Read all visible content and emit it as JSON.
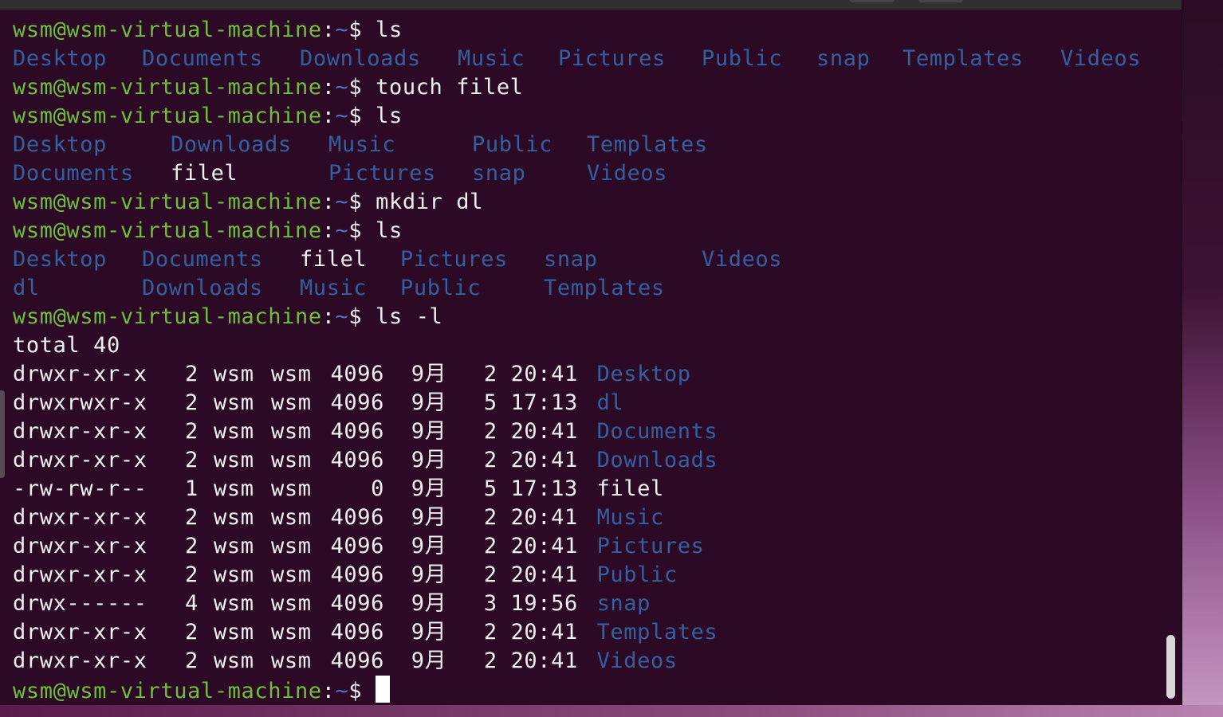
{
  "colors": {
    "terminal_bg": "#2c0a25",
    "prompt_user": "#6fbf3a",
    "prompt_path": "#4f77b8",
    "directory": "#33609f",
    "text": "#f0f0f0"
  },
  "prompt": {
    "user_host": "wsm@wsm-virtual-machine",
    "colon": ":",
    "path": "~",
    "symbol": "$ "
  },
  "session": [
    {
      "command": "ls"
    },
    {
      "ls_row": [
        "Desktop",
        "Documents",
        "Downloads",
        "Music",
        "Pictures",
        "Public",
        "snap",
        "Templates",
        "Videos"
      ]
    },
    {
      "command": "touch filel"
    },
    {
      "command": "ls"
    },
    {
      "ls_row2a": [
        "Desktop",
        "Downloads",
        "Music",
        "Public",
        "Templates"
      ]
    },
    {
      "ls_row2b": [
        "Documents",
        "filel",
        "Pictures",
        "snap",
        "Videos"
      ]
    },
    {
      "command": "mkdir dl"
    },
    {
      "command": "ls"
    },
    {
      "ls_row3a": [
        "Desktop",
        "Documents",
        "filel",
        "Pictures",
        "snap",
        "Videos"
      ]
    },
    {
      "ls_row3b": [
        "dl",
        "Downloads",
        "Music",
        "Public",
        "Templates"
      ]
    },
    {
      "command": "ls -l"
    }
  ],
  "commands": {
    "c1": "ls",
    "c2": "touch filel",
    "c3": "ls",
    "c4": "mkdir dl",
    "c5": "ls",
    "c6": "ls -l"
  },
  "ls1": [
    "Desktop",
    "Documents",
    "Downloads",
    "Music",
    "Pictures",
    "Public",
    "snap",
    "Templates",
    "Videos"
  ],
  "ls2": {
    "row1": [
      "Desktop",
      "Downloads",
      "Music",
      "Public",
      "Templates"
    ],
    "row2": [
      "Documents",
      "filel",
      "Pictures",
      "snap",
      "Videos"
    ]
  },
  "ls3": {
    "row1": [
      "Desktop",
      "Documents",
      "filel",
      "Pictures",
      "snap",
      "Videos"
    ],
    "row2": [
      "dl",
      "Downloads",
      "Music",
      "Public",
      "Templates"
    ]
  },
  "ls_long": {
    "total": "total 40",
    "entries": [
      {
        "perm": "drwxr-xr-x",
        "links": "2",
        "owner": "wsm",
        "group": "wsm",
        "size": "4096",
        "month": "9月",
        "day": "2",
        "time": "20:41",
        "name": "Desktop",
        "is_dir": true
      },
      {
        "perm": "drwxrwxr-x",
        "links": "2",
        "owner": "wsm",
        "group": "wsm",
        "size": "4096",
        "month": "9月",
        "day": "5",
        "time": "17:13",
        "name": "dl",
        "is_dir": true
      },
      {
        "perm": "drwxr-xr-x",
        "links": "2",
        "owner": "wsm",
        "group": "wsm",
        "size": "4096",
        "month": "9月",
        "day": "2",
        "time": "20:41",
        "name": "Documents",
        "is_dir": true
      },
      {
        "perm": "drwxr-xr-x",
        "links": "2",
        "owner": "wsm",
        "group": "wsm",
        "size": "4096",
        "month": "9月",
        "day": "2",
        "time": "20:41",
        "name": "Downloads",
        "is_dir": true
      },
      {
        "perm": "-rw-rw-r--",
        "links": "1",
        "owner": "wsm",
        "group": "wsm",
        "size": "0",
        "month": "9月",
        "day": "5",
        "time": "17:13",
        "name": "filel",
        "is_dir": false
      },
      {
        "perm": "drwxr-xr-x",
        "links": "2",
        "owner": "wsm",
        "group": "wsm",
        "size": "4096",
        "month": "9月",
        "day": "2",
        "time": "20:41",
        "name": "Music",
        "is_dir": true
      },
      {
        "perm": "drwxr-xr-x",
        "links": "2",
        "owner": "wsm",
        "group": "wsm",
        "size": "4096",
        "month": "9月",
        "day": "2",
        "time": "20:41",
        "name": "Pictures",
        "is_dir": true
      },
      {
        "perm": "drwxr-xr-x",
        "links": "2",
        "owner": "wsm",
        "group": "wsm",
        "size": "4096",
        "month": "9月",
        "day": "2",
        "time": "20:41",
        "name": "Public",
        "is_dir": true
      },
      {
        "perm": "drwx------",
        "links": "4",
        "owner": "wsm",
        "group": "wsm",
        "size": "4096",
        "month": "9月",
        "day": "3",
        "time": "19:56",
        "name": "snap",
        "is_dir": true
      },
      {
        "perm": "drwxr-xr-x",
        "links": "2",
        "owner": "wsm",
        "group": "wsm",
        "size": "4096",
        "month": "9月",
        "day": "2",
        "time": "20:41",
        "name": "Templates",
        "is_dir": true
      },
      {
        "perm": "drwxr-xr-x",
        "links": "2",
        "owner": "wsm",
        "group": "wsm",
        "size": "4096",
        "month": "9月",
        "day": "2",
        "time": "20:41",
        "name": "Videos",
        "is_dir": true
      }
    ]
  }
}
